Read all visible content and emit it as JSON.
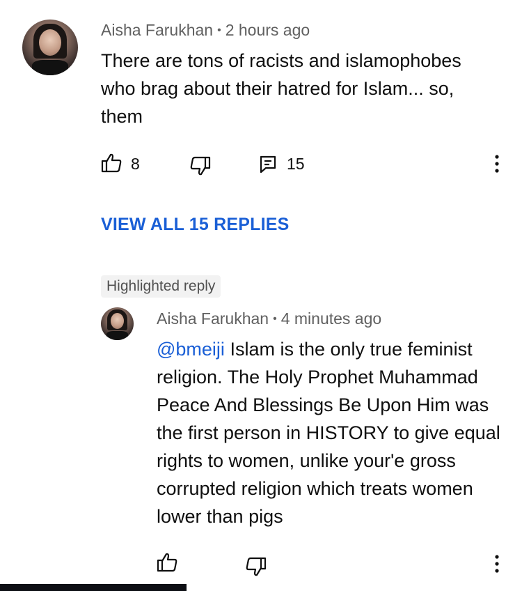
{
  "comment": {
    "author": "Aisha Farukhan",
    "time": "2 hours ago",
    "text": "There are tons of racists and islamophobes who brag about their hatred for Islam... so, them",
    "likes": "8",
    "replies_count": "15",
    "view_replies_label": "VIEW ALL 15 REPLIES"
  },
  "highlighted_badge": "Highlighted reply",
  "reply": {
    "author": "Aisha Farukhan",
    "time": "4 minutes ago",
    "mention": "@bmeiji",
    "text": " Islam is the only true feminist religion. The Holy Prophet Muhammad Peace And Blessings Be Upon Him was the first person in HISTORY to give equal rights to women, unlike your'e gross corrupted religion which treats women lower than pigs"
  },
  "icons": {
    "like": "thumbs-up-icon",
    "dislike": "thumbs-down-icon",
    "reply": "comment-icon",
    "more": "more-vertical-icon"
  }
}
